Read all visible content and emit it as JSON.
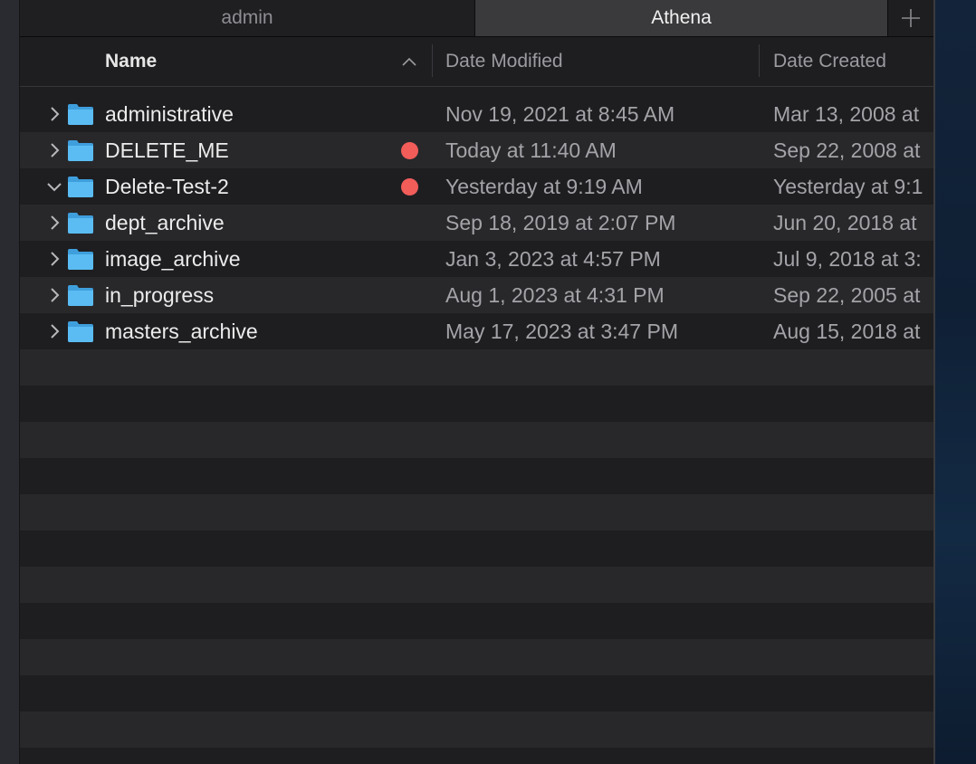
{
  "tabs": [
    {
      "label": "admin",
      "active": false
    },
    {
      "label": "Athena",
      "active": true
    }
  ],
  "new_tab_icon": "plus-icon",
  "columns": {
    "name": "Name",
    "date_modified": "Date Modified",
    "date_created": "Date Created",
    "sort_indicator": "chevron-up-icon"
  },
  "rows": [
    {
      "name": "administrative",
      "expanded": false,
      "tag": null,
      "modified": "Nov 19, 2021 at 8:45 AM",
      "created": "Mar 13, 2008 at"
    },
    {
      "name": "DELETE_ME",
      "expanded": false,
      "tag": "red",
      "modified": "Today at 11:40 AM",
      "created": "Sep 22, 2008 at"
    },
    {
      "name": "Delete-Test-2",
      "expanded": true,
      "tag": "red",
      "modified": "Yesterday at 9:19 AM",
      "created": "Yesterday at 9:1"
    },
    {
      "name": "dept_archive",
      "expanded": false,
      "tag": null,
      "modified": "Sep 18, 2019 at 2:07 PM",
      "created": "Jun 20, 2018 at"
    },
    {
      "name": "image_archive",
      "expanded": false,
      "tag": null,
      "modified": "Jan 3, 2023 at 4:57 PM",
      "created": "Jul 9, 2018 at 3:"
    },
    {
      "name": "in_progress",
      "expanded": false,
      "tag": null,
      "modified": "Aug 1, 2023 at 4:31 PM",
      "created": "Sep 22, 2005 at"
    },
    {
      "name": "masters_archive",
      "expanded": false,
      "tag": null,
      "modified": "May 17, 2023 at 3:47 PM",
      "created": "Aug 15, 2018 at"
    }
  ],
  "colors": {
    "folder": "#4fb3ef",
    "tag_red": "#f25d5a",
    "row_alt": "#28282b",
    "window_bg": "#1e1e21"
  }
}
